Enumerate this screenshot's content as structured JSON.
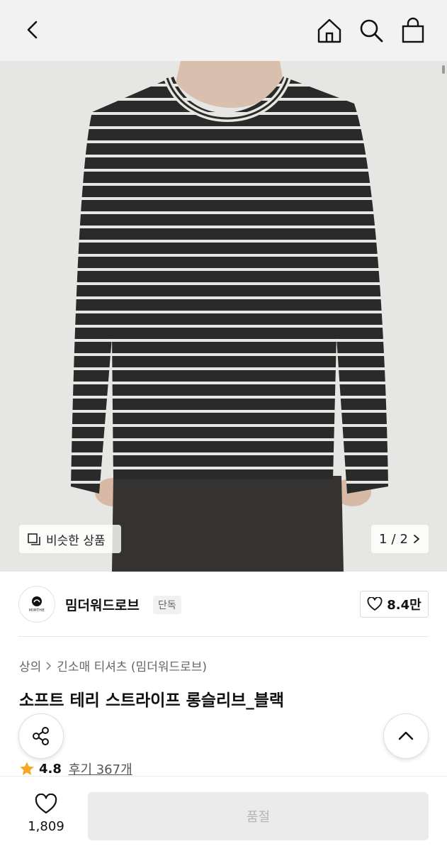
{
  "topbar": {
    "back_icon": "chevron-left-icon",
    "home_icon": "home-icon",
    "search_icon": "search-icon",
    "cart_icon": "shopping-bag-icon"
  },
  "gallery": {
    "similar_label": "비슷한 상품",
    "page_current": "1",
    "page_total": "2",
    "page_separator": "/"
  },
  "brand": {
    "name": "밈더워드로브",
    "logo_text": "MIMTHE",
    "badge": "단독",
    "likes": "8.4만"
  },
  "breadcrumb": {
    "category": "상의",
    "subcategory": "긴소매 티셔츠 (밈더워드로브)"
  },
  "product": {
    "title": "소프트 테리 스트라이프 롱슬리브_블랙",
    "rating": "4.8",
    "reviews": "후기 367개"
  },
  "bottom": {
    "wish_count": "1,809",
    "soldout_label": "품절"
  },
  "colors": {
    "topbar_bg": "#f2f2f2",
    "star": "#f5a623",
    "disabled_button": "#ebebeb",
    "disabled_text": "#b5b5b5"
  }
}
